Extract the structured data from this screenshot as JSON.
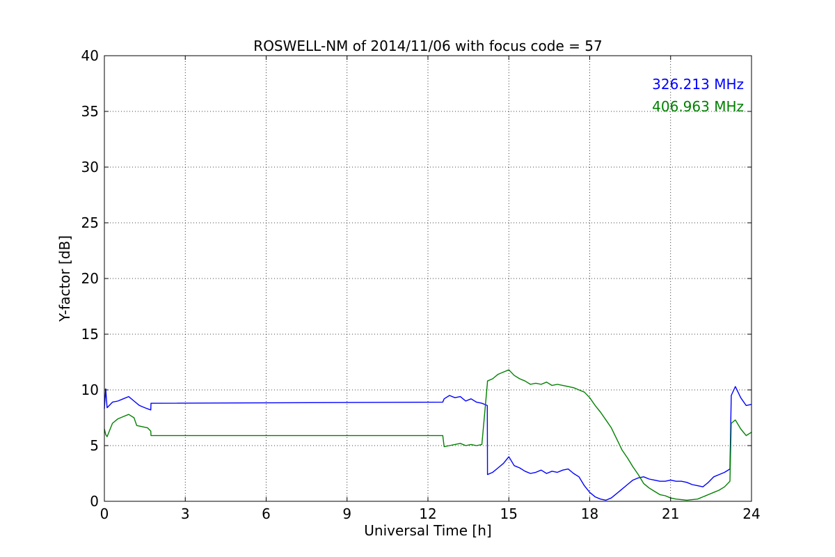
{
  "chart_data": {
    "type": "line",
    "title": "ROSWELL-NM of 2014/11/06 with focus code = 57",
    "xlabel": "Universal Time [h]",
    "ylabel": "Y-factor [dB]",
    "xlim": [
      0,
      24
    ],
    "ylim": [
      0,
      40
    ],
    "xticks": [
      0,
      3,
      6,
      9,
      12,
      15,
      18,
      21,
      24
    ],
    "yticks": [
      0,
      5,
      10,
      15,
      20,
      25,
      30,
      35,
      40
    ],
    "grid": true,
    "legend_position": "top-right",
    "series": [
      {
        "name": "326.213 MHz",
        "color": "#0000ff",
        "x": [
          0.0,
          0.05,
          0.1,
          0.3,
          0.5,
          0.7,
          0.9,
          1.1,
          1.3,
          1.5,
          1.72,
          1.73,
          12.55,
          12.6,
          12.8,
          13.0,
          13.2,
          13.4,
          13.6,
          13.8,
          14.0,
          14.2,
          14.21,
          14.4,
          14.6,
          14.8,
          15.0,
          15.2,
          15.4,
          15.6,
          15.8,
          16.0,
          16.2,
          16.4,
          16.6,
          16.8,
          17.0,
          17.2,
          17.4,
          17.6,
          17.8,
          18.0,
          18.2,
          18.4,
          18.6,
          18.8,
          19.0,
          19.2,
          19.4,
          19.6,
          19.8,
          20.0,
          20.2,
          20.4,
          20.6,
          20.8,
          21.0,
          21.2,
          21.4,
          21.6,
          21.8,
          22.0,
          22.2,
          22.4,
          22.6,
          22.8,
          23.0,
          23.2,
          23.25,
          23.4,
          23.6,
          23.8,
          24.0
        ],
        "y": [
          8.3,
          10.1,
          8.4,
          8.9,
          9.0,
          9.2,
          9.4,
          9.0,
          8.6,
          8.4,
          8.2,
          8.8,
          8.9,
          9.2,
          9.5,
          9.3,
          9.4,
          9.0,
          9.2,
          8.9,
          8.8,
          8.6,
          2.4,
          2.6,
          3.0,
          3.4,
          4.0,
          3.2,
          3.0,
          2.7,
          2.5,
          2.6,
          2.8,
          2.5,
          2.7,
          2.6,
          2.8,
          2.9,
          2.5,
          2.2,
          1.4,
          0.8,
          0.4,
          0.2,
          0.1,
          0.3,
          0.7,
          1.1,
          1.5,
          1.9,
          2.1,
          2.2,
          2.0,
          1.9,
          1.8,
          1.8,
          1.9,
          1.8,
          1.8,
          1.7,
          1.5,
          1.4,
          1.3,
          1.7,
          2.2,
          2.4,
          2.6,
          2.9,
          9.5,
          10.3,
          9.3,
          8.6,
          8.7
        ]
      },
      {
        "name": "406.963 MHz",
        "color": "#008000",
        "x": [
          0.0,
          0.05,
          0.1,
          0.3,
          0.5,
          0.7,
          0.9,
          1.1,
          1.2,
          1.4,
          1.6,
          1.72,
          1.73,
          12.55,
          12.6,
          12.8,
          13.0,
          13.2,
          13.4,
          13.6,
          13.8,
          14.0,
          14.2,
          14.21,
          14.4,
          14.6,
          14.8,
          15.0,
          15.2,
          15.4,
          15.6,
          15.8,
          16.0,
          16.2,
          16.4,
          16.6,
          16.8,
          17.0,
          17.2,
          17.4,
          17.6,
          17.8,
          18.0,
          18.2,
          18.4,
          18.6,
          18.8,
          19.0,
          19.2,
          19.4,
          19.6,
          19.8,
          20.0,
          20.2,
          20.4,
          20.6,
          20.8,
          21.0,
          21.2,
          21.4,
          21.6,
          21.8,
          22.0,
          22.2,
          22.4,
          22.6,
          22.8,
          23.0,
          23.2,
          23.25,
          23.4,
          23.6,
          23.8,
          24.0
        ],
        "y": [
          6.5,
          6.0,
          5.8,
          7.0,
          7.4,
          7.6,
          7.8,
          7.5,
          6.8,
          6.7,
          6.6,
          6.3,
          5.9,
          5.9,
          4.9,
          5.0,
          5.1,
          5.2,
          5.0,
          5.1,
          5.0,
          5.1,
          10.5,
          10.8,
          11.0,
          11.4,
          11.6,
          11.8,
          11.3,
          11.0,
          10.8,
          10.5,
          10.6,
          10.5,
          10.7,
          10.4,
          10.5,
          10.4,
          10.3,
          10.2,
          10.0,
          9.8,
          9.3,
          8.6,
          8.0,
          7.3,
          6.6,
          5.6,
          4.6,
          3.9,
          3.1,
          2.4,
          1.6,
          1.2,
          0.9,
          0.6,
          0.5,
          0.3,
          0.2,
          0.15,
          0.1,
          0.15,
          0.2,
          0.4,
          0.6,
          0.8,
          1.0,
          1.3,
          1.8,
          7.0,
          7.3,
          6.5,
          5.9,
          6.2
        ]
      }
    ]
  }
}
